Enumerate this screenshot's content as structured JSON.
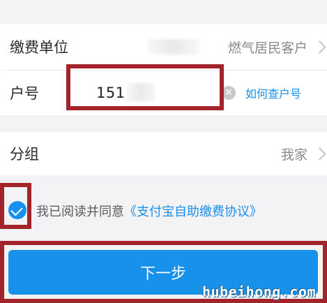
{
  "payee_row": {
    "label": "缴费单位",
    "value": "燃气居民客户"
  },
  "account_row": {
    "label": "户号",
    "input_value": "151",
    "help_link": "如何查户号"
  },
  "group_row": {
    "label": "分组",
    "value": "我家"
  },
  "agreement": {
    "text": "我已阅读并同意",
    "link": "《支付宝自助缴费协议》",
    "checked": true
  },
  "next_button": {
    "label": "下一步"
  },
  "watermark": "hubeihong.com",
  "colors": {
    "accent": "#1791ea",
    "link": "#1a8ee8",
    "annotation": "#a3232a"
  }
}
